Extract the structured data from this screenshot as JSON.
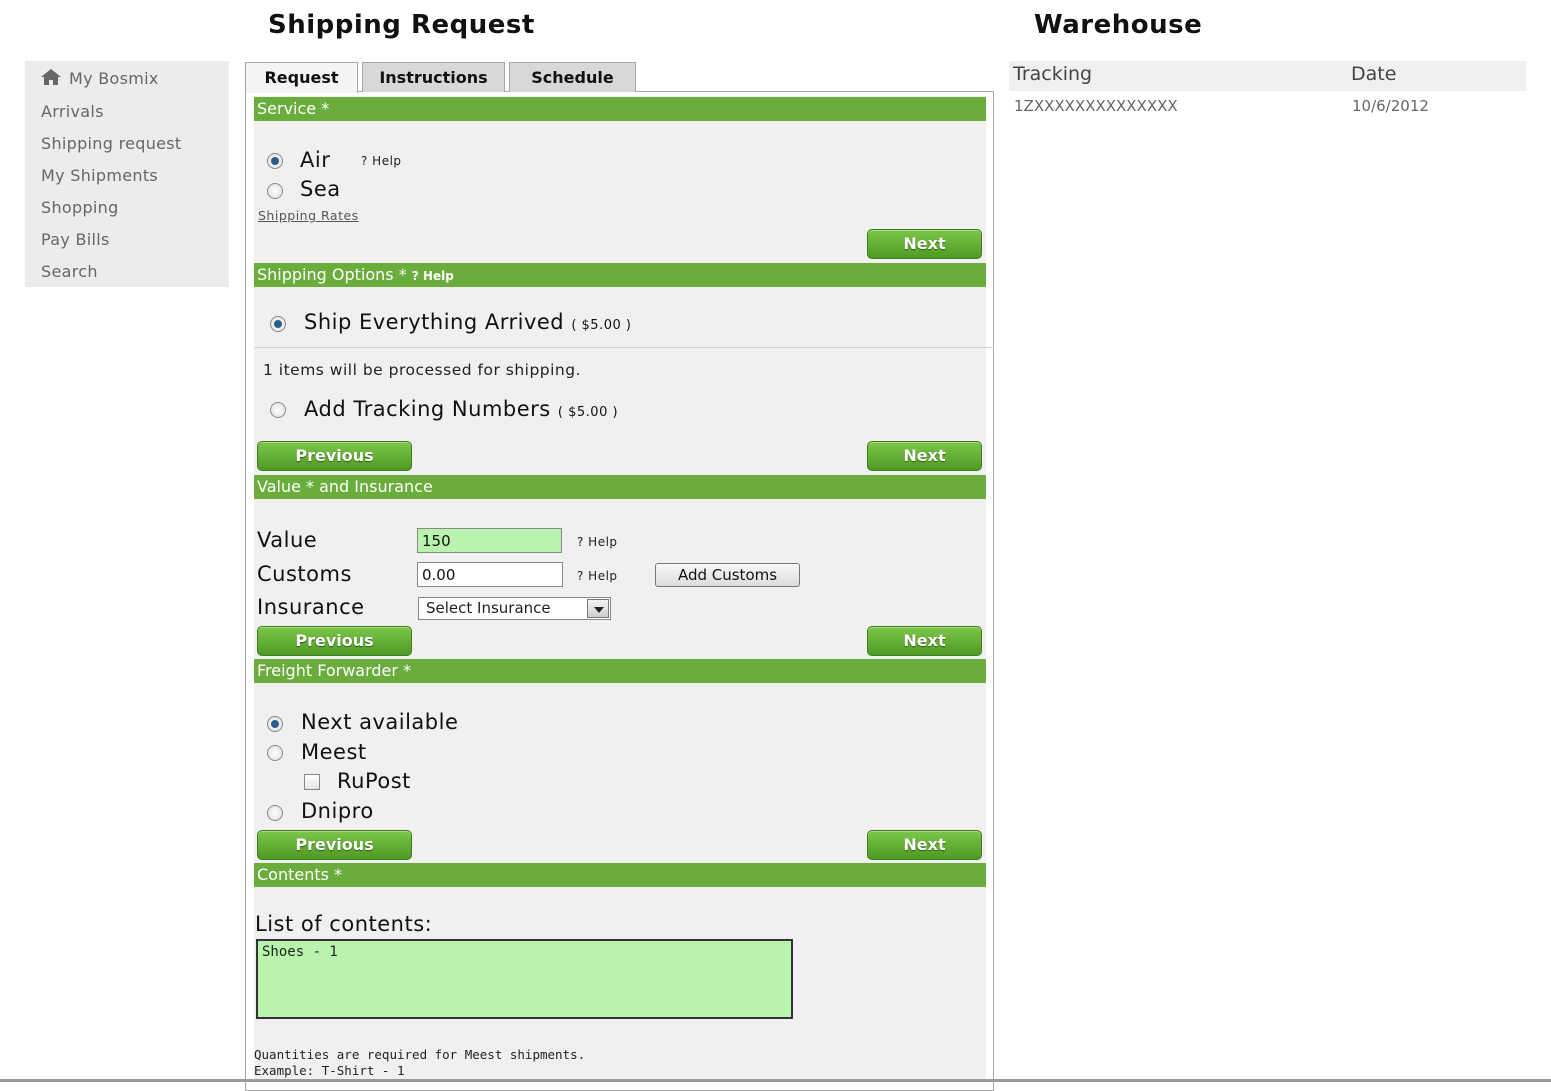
{
  "page": {
    "title": "Shipping Request",
    "warehouse_title": "Warehouse"
  },
  "sidebar": {
    "items": [
      {
        "label": "My Bosmix",
        "icon": "home-icon"
      },
      {
        "label": "Arrivals"
      },
      {
        "label": "Shipping request"
      },
      {
        "label": "My Shipments"
      },
      {
        "label": "Shopping"
      },
      {
        "label": "Pay Bills"
      },
      {
        "label": "Search"
      }
    ]
  },
  "tabs": [
    {
      "label": "Request",
      "active": true
    },
    {
      "label": "Instructions",
      "active": false
    },
    {
      "label": "Schedule",
      "active": false
    }
  ],
  "buttons": {
    "next": "Next",
    "previous": "Previous"
  },
  "service": {
    "header": "Service *",
    "options": [
      {
        "label": "Air",
        "selected": true
      },
      {
        "label": "Sea",
        "selected": false
      }
    ],
    "help": "? Help",
    "rates_link": "Shipping Rates"
  },
  "shipping_options": {
    "header": "Shipping Options *",
    "help": "? Help",
    "ship_everything": {
      "label": "Ship Everything Arrived",
      "price": "( $5.00 )",
      "selected": true
    },
    "info": "1 items will be processed for shipping.",
    "add_tracking": {
      "label": "Add Tracking Numbers",
      "price": "( $5.00 )",
      "selected": false
    }
  },
  "value_insurance": {
    "header": "Value * and Insurance",
    "value_label": "Value",
    "value": "150",
    "customs_label": "Customs",
    "customs": "0.00",
    "help": "? Help",
    "add_customs": "Add Customs",
    "insurance_label": "Insurance",
    "insurance_selected": "Select Insurance"
  },
  "freight": {
    "header": "Freight Forwarder *",
    "options": [
      {
        "label": "Next available",
        "selected": true
      },
      {
        "label": "Meest",
        "selected": false
      },
      {
        "label": "RuPost",
        "checked": false
      },
      {
        "label": "Dnipro",
        "selected": false
      }
    ]
  },
  "contents": {
    "header": "Contents *",
    "list_label": "List of contents:",
    "value": "Shoes - 1",
    "note_line1": "Quantities are required for Meest shipments.",
    "note_line2": "Example: T-Shirt - 1"
  },
  "warehouse": {
    "columns": [
      "Tracking",
      "Date"
    ],
    "rows": [
      {
        "tracking": "1ZXXXXXXXXXXXXXX",
        "date": "10/6/2012"
      }
    ]
  },
  "colors": {
    "section_header": "#6aad3c",
    "button_green": "#5aa82c",
    "input_highlight": "#b8f4ae",
    "panel_bg": "#f0f0f0"
  }
}
